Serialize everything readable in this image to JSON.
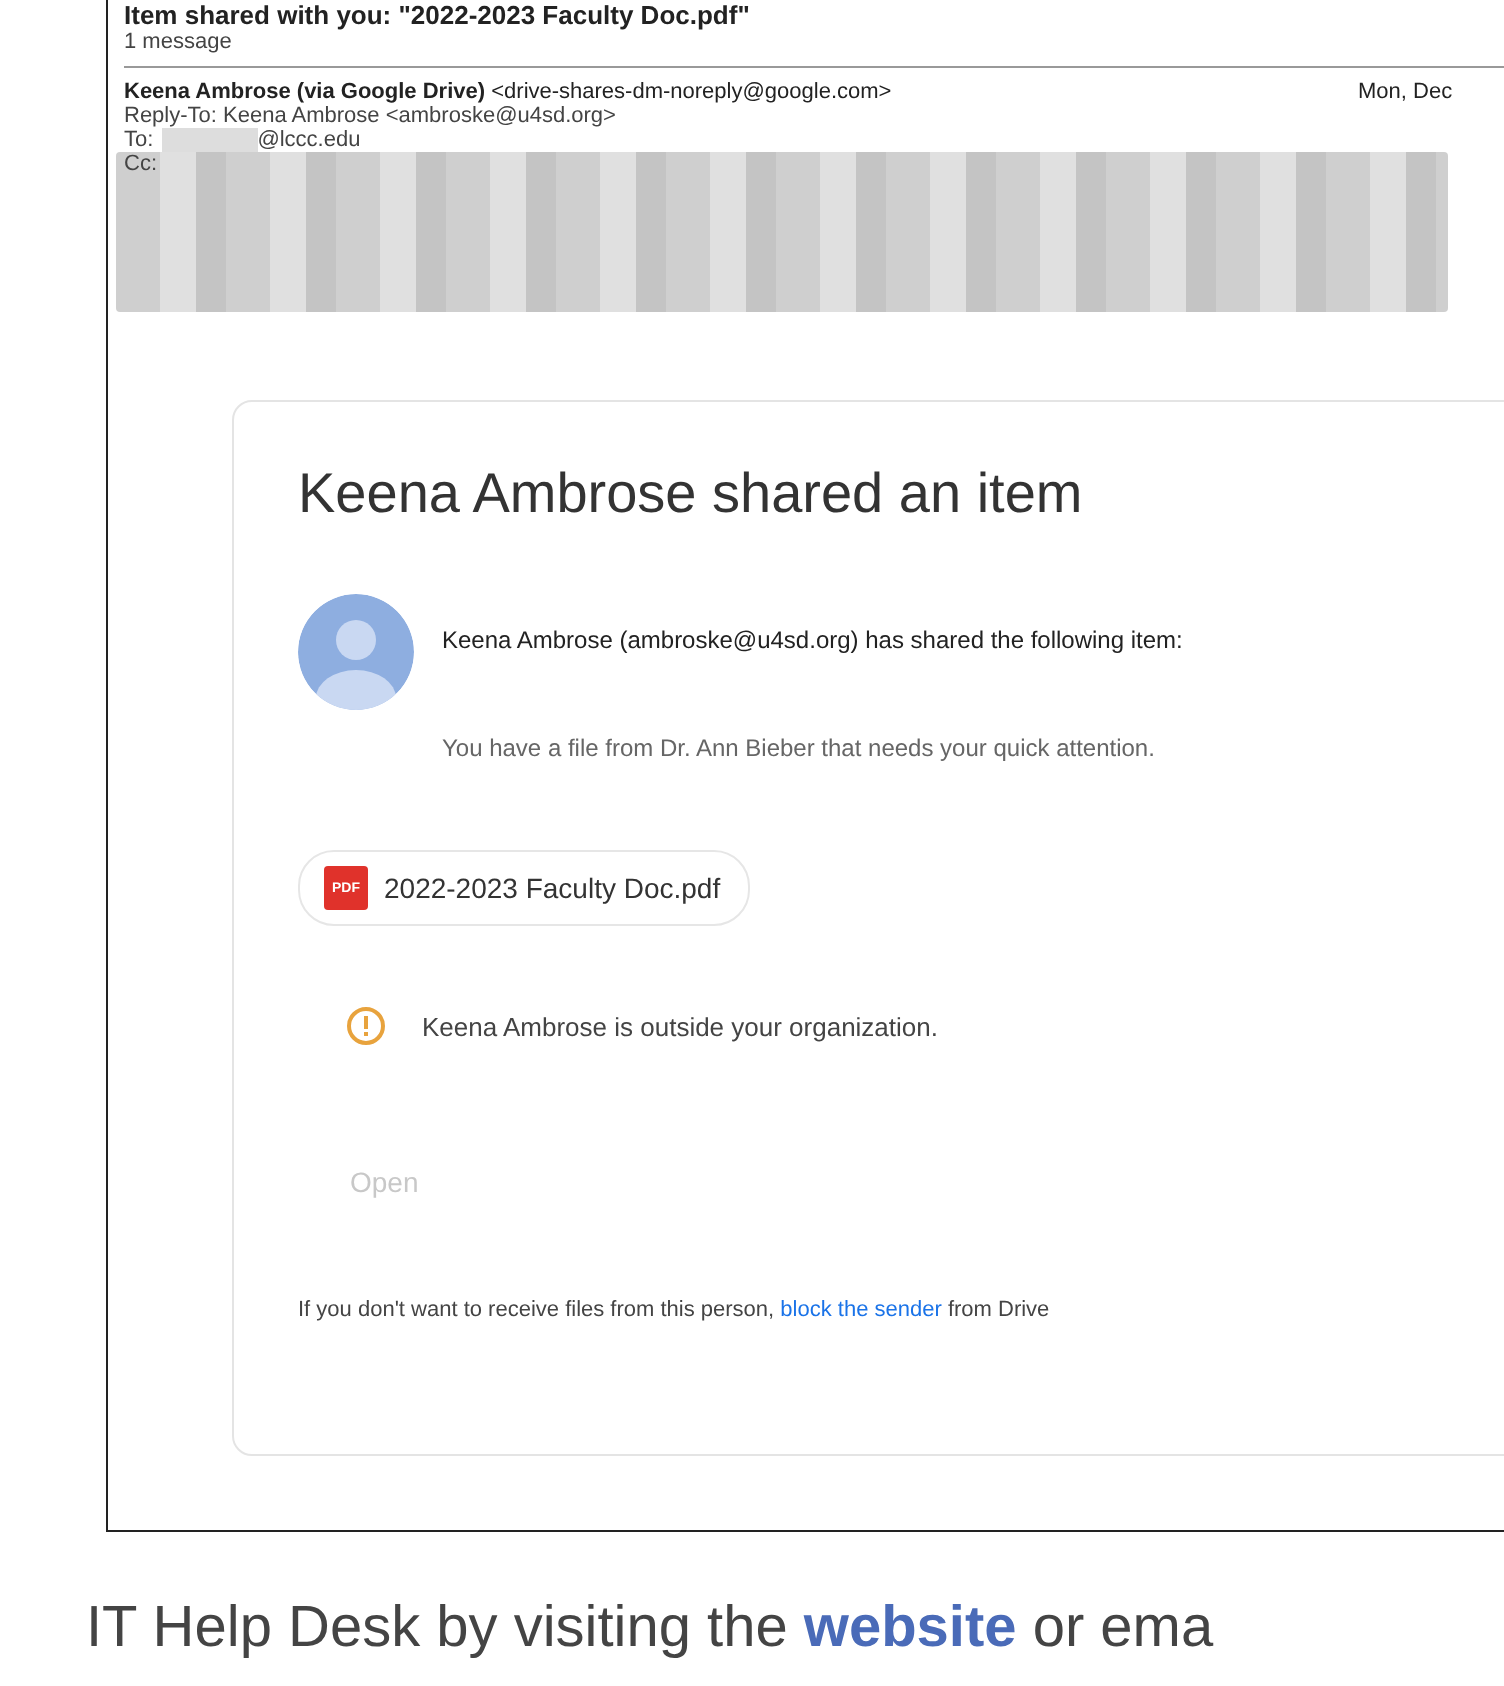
{
  "email": {
    "subject": "Item shared with you: \"2022-2023 Faculty Doc.pdf\"",
    "message_count": "1 message",
    "sender_name": "Keena Ambrose (via Google Drive)",
    "sender_address": "<drive-shares-dm-noreply@google.com>",
    "date": "Mon, Dec",
    "reply_to": "Reply-To: Keena Ambrose <ambroske@u4sd.org>",
    "to_label": "To:",
    "to_domain": "@lccc.edu",
    "cc_label": "Cc:"
  },
  "card": {
    "title": "Keena Ambrose shared an item",
    "shared_line": "Keena Ambrose (ambroske@u4sd.org) has shared the following item:",
    "message": "You have a file from Dr. Ann Bieber that needs your quick attention.",
    "file_badge": "PDF",
    "file_name": "2022-2023 Faculty Doc.pdf",
    "warning": "Keena Ambrose is outside your organization.",
    "open_button": {
      "label": "Open",
      "disabled": true
    },
    "footer_before": "If you don't want to receive files from this person, ",
    "footer_link": "block the sender",
    "footer_after": " from Drive"
  },
  "caption": {
    "before": "IT Help Desk by visiting the ",
    "link": "website",
    "after": " or ema"
  }
}
